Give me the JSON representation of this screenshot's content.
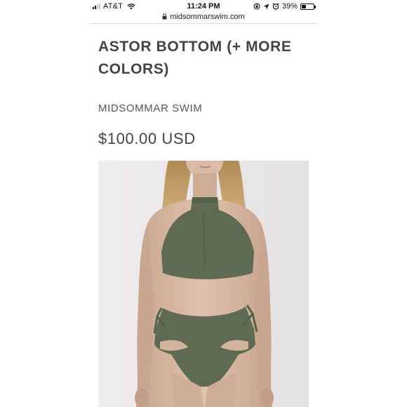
{
  "status_bar": {
    "carrier": "AT&T",
    "time": "11:24 PM",
    "battery_percent": "39%",
    "battery_level": 0.39,
    "signal_bars_on": 2,
    "signal_bars_total": 4,
    "icons": [
      "signal-icon",
      "wifi-icon",
      "screen-lock-rotation-icon",
      "location-arrow-icon",
      "alarm-icon",
      "battery-icon"
    ]
  },
  "browser": {
    "url": "midsommarswim.com",
    "icons": [
      "lock-icon"
    ]
  },
  "product": {
    "title": "ASTOR BOTTOM (+ MORE COLORS)",
    "vendor": "MIDSOMMAR SWIM",
    "price": "$100.00 USD"
  },
  "colors": {
    "swimsuit_olive": "#5f6a52",
    "background": "#ffffff",
    "text": "#444444"
  }
}
